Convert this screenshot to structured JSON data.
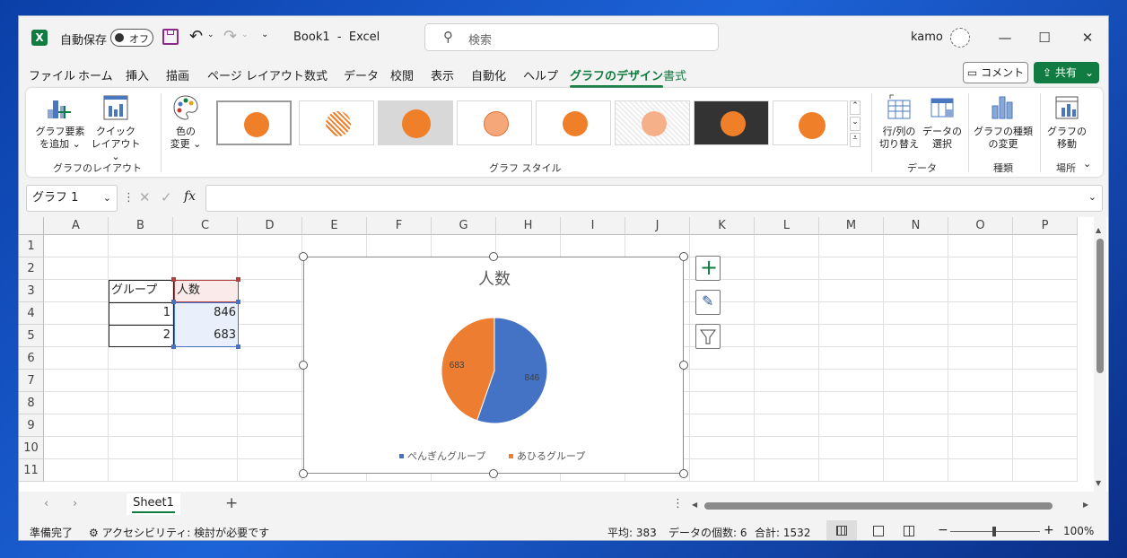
{
  "title": {
    "autosave_label": "自動保存",
    "autosave_state": "オフ",
    "book": "Book1",
    "separator": "-",
    "app": "Excel",
    "search_placeholder": "検索",
    "user": "kamo"
  },
  "menu": {
    "items": [
      "ファイル",
      "ホーム",
      "挿入",
      "描画",
      "ページ レイアウト",
      "数式",
      "データ",
      "校閲",
      "表示",
      "自動化",
      "ヘルプ",
      "グラフのデザイン",
      "書式"
    ],
    "comment": "コメント",
    "share": "共有"
  },
  "ribbon": {
    "add_element": [
      "グラフ要素",
      "を追加"
    ],
    "quick_layout": [
      "クイック",
      "レイアウト"
    ],
    "change_color": [
      "色の",
      "変更"
    ],
    "group_layout": "グラフのレイアウト",
    "group_style": "グラフ スタイル",
    "switch_row_col": [
      "行/列の",
      "切り替え"
    ],
    "select_data": [
      "データの",
      "選択"
    ],
    "group_data": "データ",
    "change_type": [
      "グラフの種類",
      "の変更"
    ],
    "group_type": "種類",
    "move_chart": [
      "グラフの",
      "移動"
    ],
    "group_location": "場所"
  },
  "formula": {
    "name_box": "グラフ 1",
    "fx": "fx"
  },
  "grid": {
    "columns": [
      "A",
      "B",
      "C",
      "D",
      "E",
      "F",
      "G",
      "H",
      "I",
      "J",
      "K",
      "L",
      "M",
      "N",
      "O",
      "P"
    ],
    "rows": [
      "1",
      "2",
      "3",
      "4",
      "5",
      "6",
      "7",
      "8",
      "9",
      "10",
      "11"
    ],
    "table": {
      "header": [
        "グループ",
        "人数"
      ],
      "rows": [
        [
          "1",
          "846"
        ],
        [
          "2",
          "683"
        ]
      ]
    }
  },
  "chart_data": {
    "type": "pie",
    "title": "人数",
    "categories": [
      "ぺんぎんグループ",
      "あひるグループ"
    ],
    "values": [
      846,
      683
    ],
    "data_labels": [
      "846",
      "683"
    ],
    "colors": [
      "#4472c4",
      "#ed7d31"
    ],
    "legend_position": "bottom"
  },
  "sheets": {
    "tabs": [
      "Sheet1"
    ],
    "add": "+"
  },
  "status": {
    "ready": "準備完了",
    "accessibility": "アクセシビリティ: 検討が必要です",
    "average": "平均: 383",
    "count": "データの個数: 6",
    "sum": "合計: 1532",
    "zoom": "100%"
  }
}
